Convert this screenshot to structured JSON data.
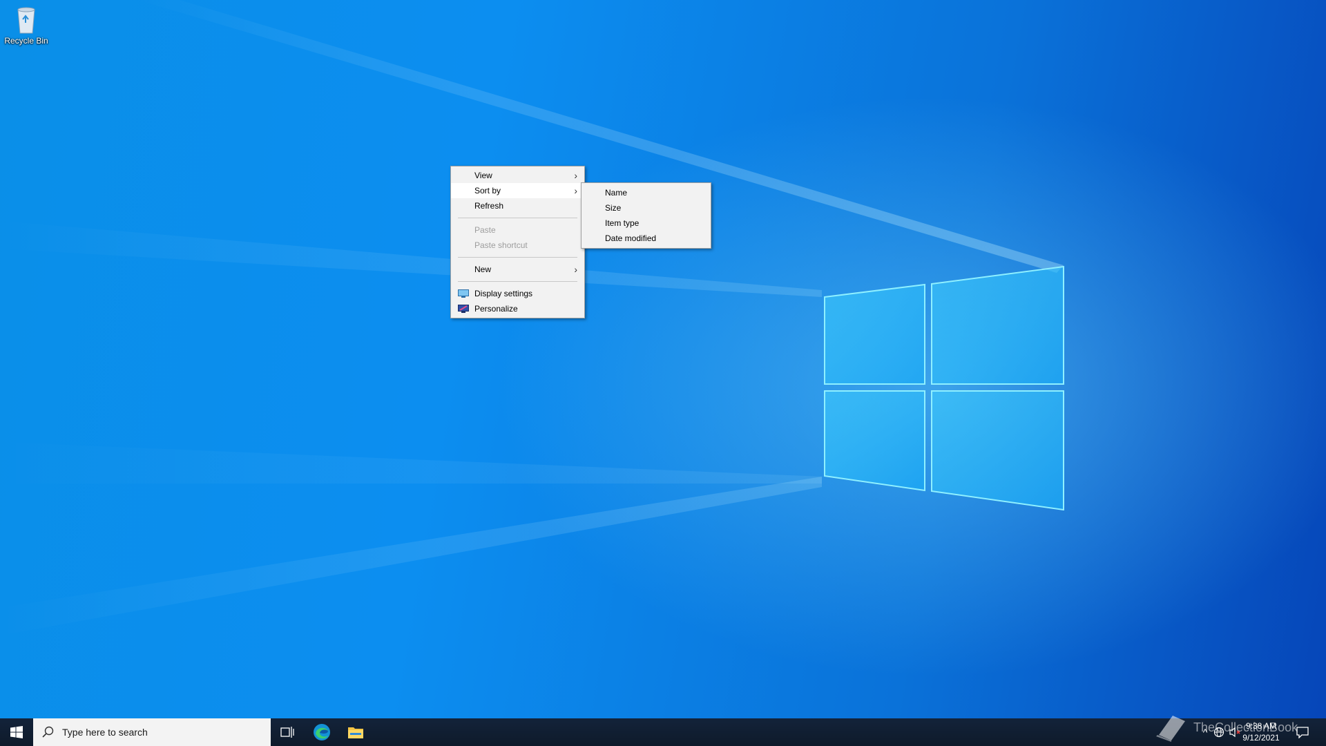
{
  "desktop": {
    "icons": [
      {
        "label": "Recycle Bin",
        "icon": "recycle-bin-icon"
      }
    ]
  },
  "context_menu": {
    "items": [
      {
        "label": "View",
        "has_submenu": true,
        "disabled": false
      },
      {
        "label": "Sort by",
        "has_submenu": true,
        "disabled": false,
        "hovered": true
      },
      {
        "label": "Refresh",
        "has_submenu": false,
        "disabled": false
      },
      {
        "label": "Paste",
        "has_submenu": false,
        "disabled": true
      },
      {
        "label": "Paste shortcut",
        "has_submenu": false,
        "disabled": true
      },
      {
        "label": "New",
        "has_submenu": true,
        "disabled": false
      },
      {
        "label": "Display settings",
        "icon": "display-icon",
        "disabled": false
      },
      {
        "label": "Personalize",
        "icon": "personalize-icon",
        "disabled": false
      }
    ],
    "submenu_arrow": ">"
  },
  "sort_submenu": {
    "items": [
      {
        "label": "Name"
      },
      {
        "label": "Size"
      },
      {
        "label": "Item type"
      },
      {
        "label": "Date modified"
      }
    ]
  },
  "taskbar": {
    "start_icon": "windows-start-icon",
    "search_placeholder": "Type here to search",
    "pinned": [
      {
        "name": "task-view-icon"
      },
      {
        "name": "edge-icon"
      },
      {
        "name": "file-explorer-icon"
      }
    ],
    "clock_time": "9:38 AM",
    "clock_date": "9/12/2021",
    "tray_icons": [
      "chevron-up-icon",
      "network-icon",
      "volume-muted-icon",
      "notification-icon"
    ]
  },
  "watermark": {
    "text": "TheCollectionBook"
  },
  "colors": {
    "wallpaper": "#0a8fe8",
    "taskbar": "#101c2b",
    "menu_bg": "#f2f2f2"
  }
}
